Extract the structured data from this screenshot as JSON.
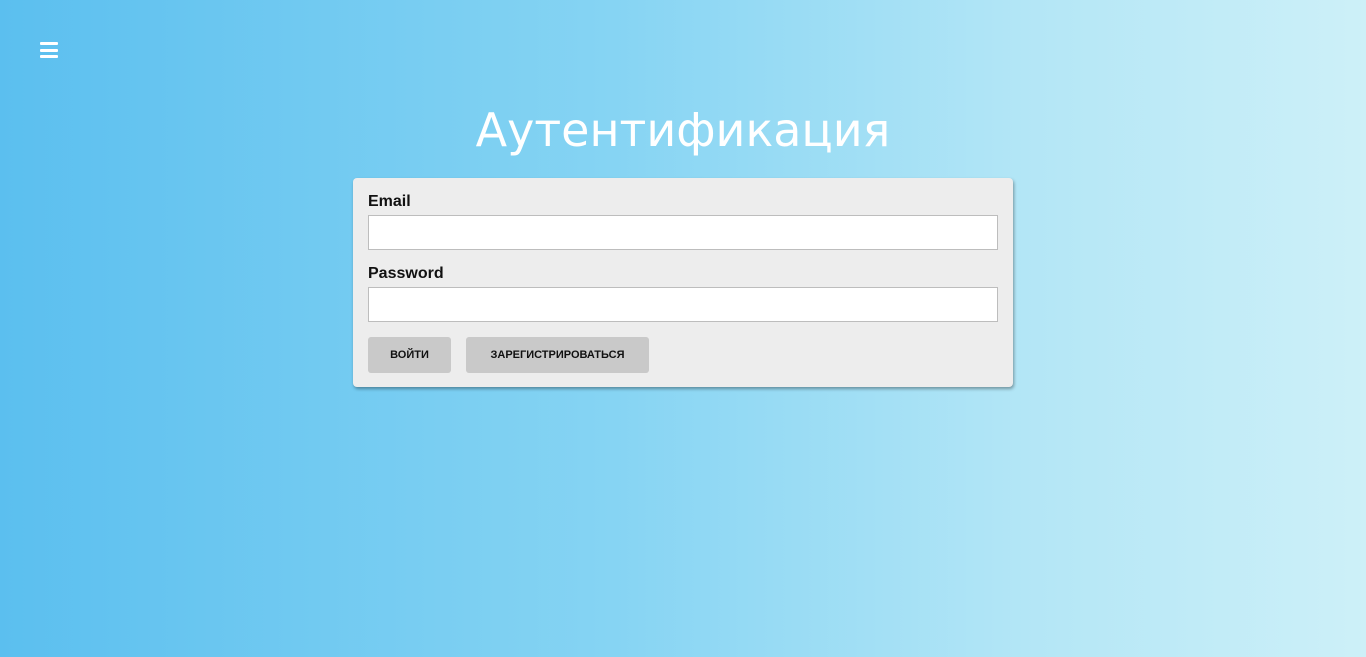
{
  "header": {
    "menu_icon": "hamburger-menu-icon"
  },
  "page": {
    "title": "Аутентификация"
  },
  "form": {
    "email_label": "Email",
    "email_value": "",
    "password_label": "Password",
    "password_value": "",
    "login_button": "ВОЙТИ",
    "register_button": "ЗАРЕГИСТРИРОВАТЬСЯ"
  },
  "colors": {
    "background_left": "#5bbfef",
    "background_right": "#cdf0f8",
    "card": "#ededed",
    "button": "#c9c9c9",
    "title": "#ffffff"
  }
}
